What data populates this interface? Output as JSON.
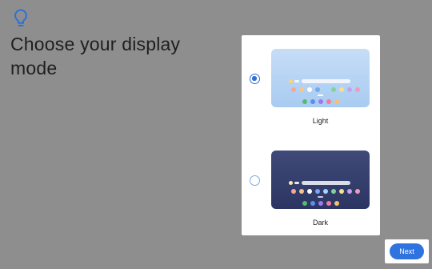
{
  "page": {
    "title": "Choose your display mode",
    "icon": "lightbulb-icon"
  },
  "options": [
    {
      "label": "Light",
      "selected": true,
      "theme": "light"
    },
    {
      "label": "Dark",
      "selected": false,
      "theme": "dark"
    }
  ],
  "preview_colors": {
    "light_row1": [
      "#f5a89a",
      "#f7c48a",
      "#ffffff",
      "#7aa6f0",
      "#a5d6f7",
      "#7fd49a",
      "#f7e08a",
      "#c9a0f0",
      "#f29bb8"
    ],
    "light_row2": [
      "#4fbf6a",
      "#5b8def",
      "#9b7af0",
      "#f07aa0",
      "#f5c26b"
    ],
    "dark_row1": [
      "#f5a89a",
      "#f7c48a",
      "#ffffff",
      "#7aa6f0",
      "#a5d6f7",
      "#7fd49a",
      "#f7e08a",
      "#c9a0f0",
      "#f29bb8"
    ],
    "dark_row2": [
      "#4fbf6a",
      "#5b8def",
      "#9b7af0",
      "#f07aa0",
      "#f5c26b"
    ]
  },
  "buttons": {
    "next_label": "Next"
  },
  "colors": {
    "accent": "#2f73e0",
    "background": "#8e8e8e"
  }
}
